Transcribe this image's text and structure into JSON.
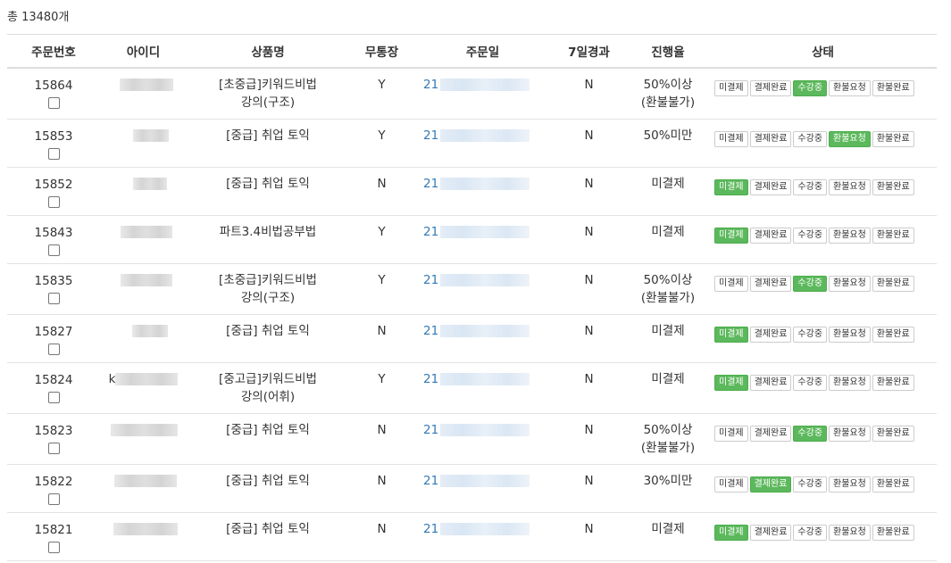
{
  "summary": "총 13480개",
  "columns": [
    "주문번호",
    "아이디",
    "상품명",
    "무통장",
    "주문일",
    "7일경과",
    "진행율",
    "상태"
  ],
  "status_labels": [
    "미결제",
    "결제완료",
    "수강중",
    "환불요청",
    "환불완료"
  ],
  "accent_color": "#5cb85c",
  "rows": [
    {
      "order": "15864",
      "id_prefix": "",
      "product": "[초중급]키워드비법강의(구조)",
      "deposit": "Y",
      "date_prefix": "21",
      "over7": "N",
      "progress": "50%이상(환불불가)",
      "status_index": 2
    },
    {
      "order": "15853",
      "id_prefix": "",
      "product": "[중급] 취업 토익",
      "deposit": "Y",
      "date_prefix": "21",
      "over7": "N",
      "progress": "50%미만",
      "status_index": 3
    },
    {
      "order": "15852",
      "id_prefix": "",
      "product": "[중급] 취업 토익",
      "deposit": "N",
      "date_prefix": "21",
      "over7": "N",
      "progress": "미결제",
      "status_index": 0
    },
    {
      "order": "15843",
      "id_prefix": "",
      "product": "파트3.4비법공부법",
      "deposit": "Y",
      "date_prefix": "21",
      "over7": "N",
      "progress": "미결제",
      "status_index": 0
    },
    {
      "order": "15835",
      "id_prefix": "",
      "product": "[초중급]키워드비법강의(구조)",
      "deposit": "Y",
      "date_prefix": "21",
      "over7": "N",
      "progress": "50%이상(환불불가)",
      "status_index": 2
    },
    {
      "order": "15827",
      "id_prefix": "",
      "product": "[중급] 취업 토익",
      "deposit": "N",
      "date_prefix": "21",
      "over7": "N",
      "progress": "미결제",
      "status_index": 0
    },
    {
      "order": "15824",
      "id_prefix": "k",
      "product": "[중고급]키워드비법강의(어휘)",
      "deposit": "Y",
      "date_prefix": "21",
      "over7": "N",
      "progress": "미결제",
      "status_index": 0
    },
    {
      "order": "15823",
      "id_prefix": "",
      "product": "[중급] 취업 토익",
      "deposit": "N",
      "date_prefix": "21",
      "over7": "N",
      "progress": "50%이상(환불불가)",
      "status_index": 2
    },
    {
      "order": "15822",
      "id_prefix": "",
      "product": "[중급] 취업 토익",
      "deposit": "N",
      "date_prefix": "21",
      "over7": "N",
      "progress": "30%미만",
      "status_index": 1
    },
    {
      "order": "15821",
      "id_prefix": "",
      "product": "[중급] 취업 토익",
      "deposit": "N",
      "date_prefix": "21",
      "over7": "N",
      "progress": "미결제",
      "status_index": 0
    }
  ]
}
